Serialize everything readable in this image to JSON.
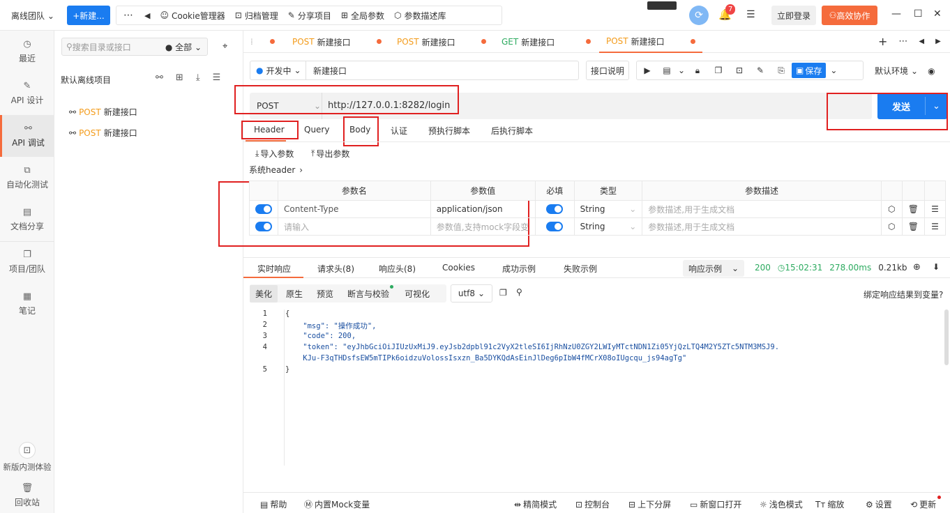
{
  "topbar": {
    "team": "离线团队",
    "new_button": "+新建...",
    "menu": [
      "Cookie管理器",
      "归档管理",
      "分享项目",
      "全局参数",
      "参数描述库"
    ],
    "notif_count": "7",
    "login": "立即登录",
    "collab": "高效协作"
  },
  "leftnav": [
    {
      "label": "最近",
      "icon": "clock-icon"
    },
    {
      "label": "API 设计",
      "icon": "edit-icon"
    },
    {
      "label": "API 调试",
      "icon": "link-icon"
    },
    {
      "label": "自动化测试",
      "icon": "flow-icon"
    },
    {
      "label": "文档分享",
      "icon": "doc-icon"
    },
    {
      "label": "项目/团队",
      "icon": "folder-icon"
    },
    {
      "label": "笔记",
      "icon": "note-icon"
    },
    {
      "label": "新版内测体验",
      "icon": "beta-icon"
    },
    {
      "label": "回收站",
      "icon": "trash-icon"
    }
  ],
  "tree": {
    "search_placeholder": "搜索目录或接口",
    "filter": "全部",
    "project": "默认离线项目",
    "items": [
      {
        "method": "POST",
        "name": "新建接口"
      },
      {
        "method": "POST",
        "name": "新建接口"
      }
    ]
  },
  "tabs": [
    {
      "method": "POST",
      "name": "新建接口"
    },
    {
      "method": "POST",
      "name": "新建接口"
    },
    {
      "method": "GET",
      "name": "新建接口"
    },
    {
      "method": "POST",
      "name": "新建接口"
    }
  ],
  "request": {
    "status": "开发中",
    "name": "新建接口",
    "doc_button": "接口说明",
    "save": "保存",
    "env": "默认环境",
    "method": "POST",
    "url": "http://127.0.0.1:8282/login",
    "send": "发送",
    "subtabs": [
      "Header",
      "Query",
      "Body",
      "认证",
      "预执行脚本",
      "后执行脚本"
    ],
    "import": "导入参数",
    "export": "导出参数",
    "sys_header": "系统header"
  },
  "params": {
    "headers": [
      "参数名",
      "参数值",
      "必填",
      "类型",
      "参数描述"
    ],
    "rows": [
      {
        "name": "Content-Type",
        "value": "application/json",
        "type": "String",
        "desc": "参数描述,用于生成文档"
      },
      {
        "name": "请输入",
        "value": "参数值,支持mock字段变",
        "type": "String",
        "desc": "参数描述,用于生成文档"
      }
    ]
  },
  "response": {
    "tabs": [
      "实时响应",
      "请求头(8)",
      "响应头(8)",
      "Cookies",
      "成功示例",
      "失败示例"
    ],
    "example_select": "响应示例",
    "status": "200",
    "time": "15:02:31",
    "duration": "278.00ms",
    "size": "0.21kb",
    "views": [
      "美化",
      "原生",
      "预览",
      "断言与校验",
      "可视化"
    ],
    "encoding": "utf8",
    "bind": "绑定响应结果到变量?",
    "line_numbers": [
      "1",
      "2",
      "3",
      "4",
      "",
      "5"
    ],
    "lines": [
      "{",
      "    \"msg\": \"操作成功\",",
      "    \"code\": 200,",
      "    \"token\": \"eyJhbGciOiJIUzUxMiJ9.eyJsb2dpbl91c2VyX2tleSI6IjRhNzU0ZGY2LWIyMTctNDN1Zi05YjQzLTQ4M2Y5ZTc5NTM3MSJ9.",
      "    KJu-F3qTHDsfsEW5mTIPk6oidzuVolossIsxzn_Ba5DYKQdAsEinJlDeg6pIbW4fMCrX08oIUgcqu_js94agTg\"",
      "}"
    ]
  },
  "footer": [
    "帮助",
    "内置Mock变量",
    "精简模式",
    "控制台",
    "上下分屏",
    "新窗口打开",
    "浅色模式",
    "缩放",
    "设置",
    "更新"
  ]
}
